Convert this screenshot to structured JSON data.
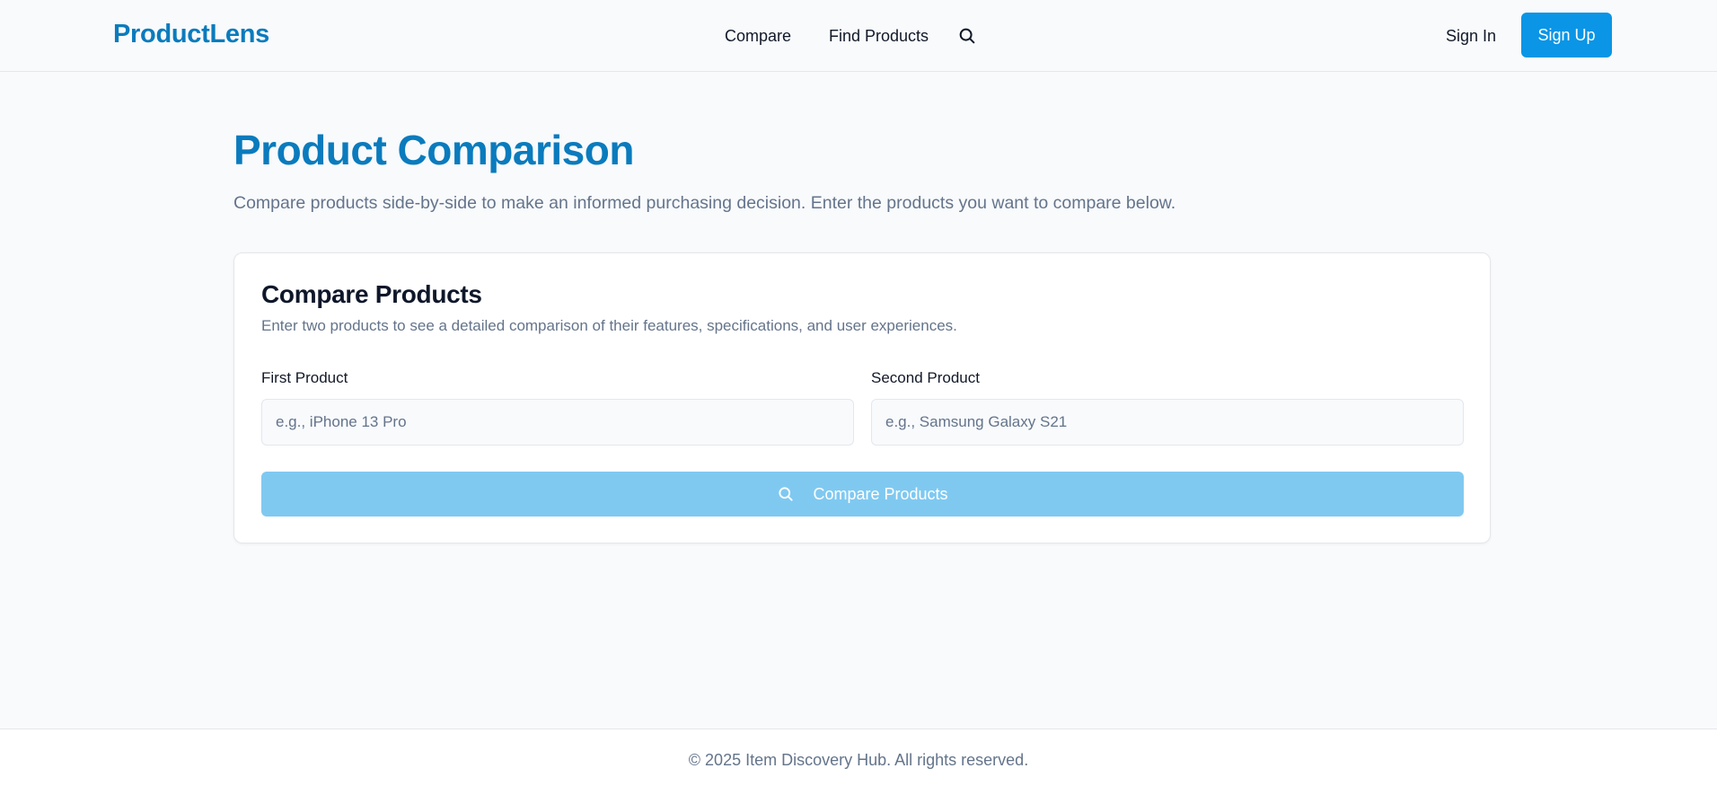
{
  "header": {
    "logo": "ProductLens",
    "nav": {
      "compare": "Compare",
      "find_products": "Find Products",
      "search_icon": "search-icon"
    },
    "sign_in": "Sign In",
    "sign_up": "Sign Up"
  },
  "main": {
    "title": "Product Comparison",
    "subtitle": "Compare products side-by-side to make an informed purchasing decision. Enter the products you want to compare below."
  },
  "card": {
    "title": "Compare Products",
    "subtitle": "Enter two products to see a detailed comparison of their features, specifications, and user experiences.",
    "first_label": "First Product",
    "first_value": "",
    "first_placeholder": "e.g., iPhone 13 Pro",
    "second_label": "Second Product",
    "second_value": "",
    "second_placeholder": "e.g., Samsung Galaxy S21",
    "button_label": "Compare Products",
    "button_icon": "search-icon"
  },
  "footer": {
    "copyright": "© 2025 Item Discovery Hub. All rights reserved."
  },
  "colors": {
    "brand": "#0a7bbd",
    "primary_button": "#0a95e6",
    "disabled_button": "#7fc9f1",
    "muted_text": "#64748b",
    "background": "#f8fafc"
  }
}
